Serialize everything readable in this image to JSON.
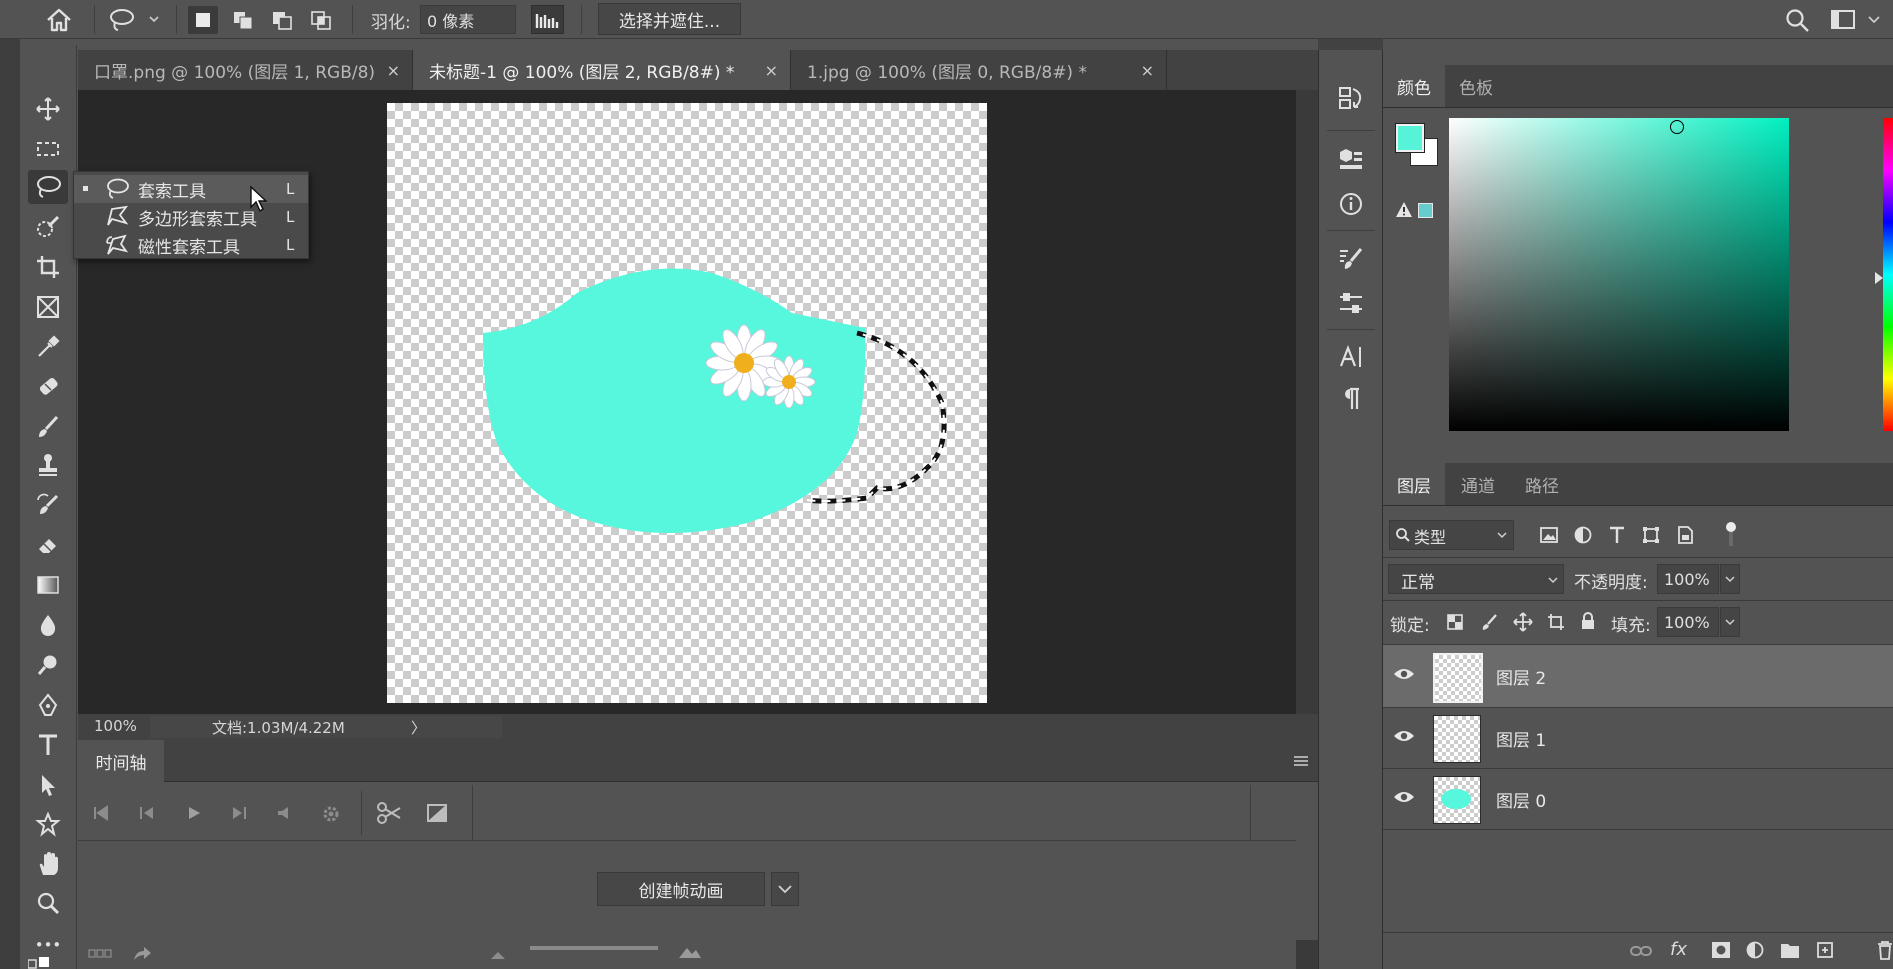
{
  "options_bar": {
    "feather_label": "羽化:",
    "feather_value": "0 像素",
    "select_and_mask": "选择并遮住..."
  },
  "tabs": [
    {
      "label": "口罩.png @ 100% (图层 1, RGB/8)",
      "close": "×"
    },
    {
      "label": "未标题-1 @ 100% (图层 2, RGB/8#) *",
      "close": "×"
    },
    {
      "label": "1.jpg @ 100% (图层 0, RGB/8#) *",
      "close": "×"
    }
  ],
  "toolbar": {
    "collapse": "»",
    "more": "•••"
  },
  "flyout": {
    "items": [
      {
        "label": "套索工具",
        "shortcut": "L"
      },
      {
        "label": "多边形套索工具",
        "shortcut": "L"
      },
      {
        "label": "磁性套索工具",
        "shortcut": "L"
      }
    ]
  },
  "status": {
    "zoom": "100%",
    "doc_info": "文档:1.03M/4.22M",
    "arrow": "〉"
  },
  "timeline": {
    "tab": "时间轴",
    "create_button": "创建帧动画"
  },
  "color_panel": {
    "tabs": [
      "颜色",
      "色板"
    ],
    "foreground": "#56f3d8",
    "background": "#ffffff",
    "hue": "#00f0c0"
  },
  "layers_panel": {
    "tabs": [
      "图层",
      "通道",
      "路径"
    ],
    "filter_label": "类型",
    "blend_mode": "正常",
    "opacity_label": "不透明度:",
    "opacity_value": "100%",
    "lock_label": "锁定:",
    "fill_label": "填充:",
    "fill_value": "100%",
    "layers": [
      {
        "name": "图层 2",
        "selected": true
      },
      {
        "name": "图层 1",
        "selected": false
      },
      {
        "name": "图层 0",
        "selected": false
      }
    ],
    "footer_fx": "fx"
  },
  "colors": {
    "mask_fill": "#56f7dc",
    "accent": "#56f3d8"
  }
}
